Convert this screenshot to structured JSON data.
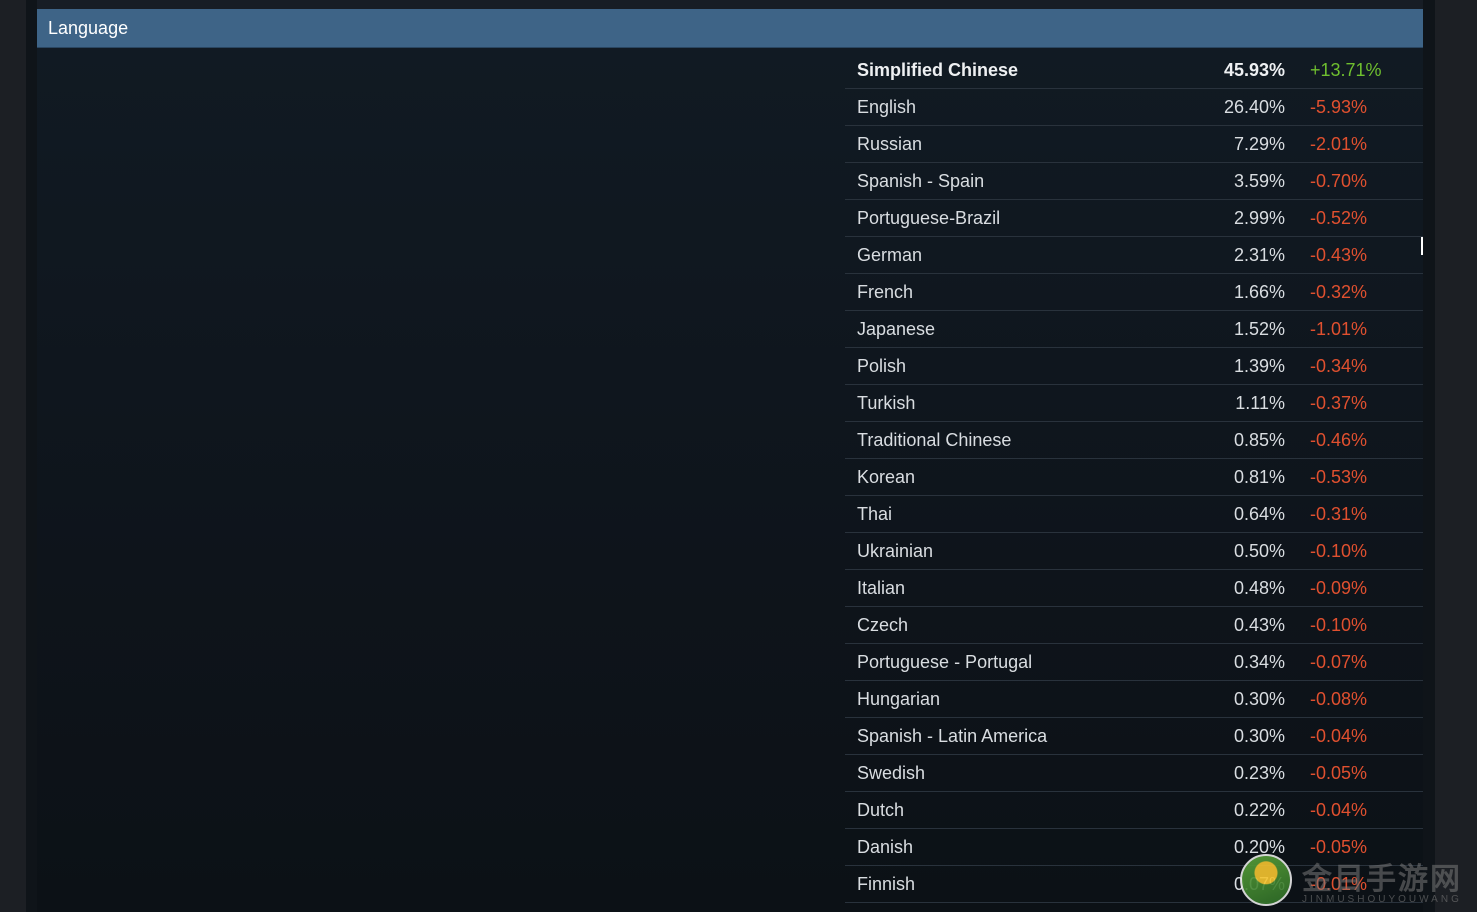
{
  "section": {
    "title": "Language"
  },
  "languages": [
    {
      "name": "Simplified Chinese",
      "share": "45.93%",
      "change": "+13.71%",
      "trend": "up"
    },
    {
      "name": "English",
      "share": "26.40%",
      "change": "-5.93%",
      "trend": "down"
    },
    {
      "name": "Russian",
      "share": "7.29%",
      "change": "-2.01%",
      "trend": "down"
    },
    {
      "name": "Spanish - Spain",
      "share": "3.59%",
      "change": "-0.70%",
      "trend": "down"
    },
    {
      "name": "Portuguese-Brazil",
      "share": "2.99%",
      "change": "-0.52%",
      "trend": "down"
    },
    {
      "name": "German",
      "share": "2.31%",
      "change": "-0.43%",
      "trend": "down"
    },
    {
      "name": "French",
      "share": "1.66%",
      "change": "-0.32%",
      "trend": "down"
    },
    {
      "name": "Japanese",
      "share": "1.52%",
      "change": "-1.01%",
      "trend": "down"
    },
    {
      "name": "Polish",
      "share": "1.39%",
      "change": "-0.34%",
      "trend": "down"
    },
    {
      "name": "Turkish",
      "share": "1.11%",
      "change": "-0.37%",
      "trend": "down"
    },
    {
      "name": "Traditional Chinese",
      "share": "0.85%",
      "change": "-0.46%",
      "trend": "down"
    },
    {
      "name": "Korean",
      "share": "0.81%",
      "change": "-0.53%",
      "trend": "down"
    },
    {
      "name": "Thai",
      "share": "0.64%",
      "change": "-0.31%",
      "trend": "down"
    },
    {
      "name": "Ukrainian",
      "share": "0.50%",
      "change": "-0.10%",
      "trend": "down"
    },
    {
      "name": "Italian",
      "share": "0.48%",
      "change": "-0.09%",
      "trend": "down"
    },
    {
      "name": "Czech",
      "share": "0.43%",
      "change": "-0.10%",
      "trend": "down"
    },
    {
      "name": "Portuguese - Portugal",
      "share": "0.34%",
      "change": "-0.07%",
      "trend": "down"
    },
    {
      "name": "Hungarian",
      "share": "0.30%",
      "change": "-0.08%",
      "trend": "down"
    },
    {
      "name": "Spanish - Latin America",
      "share": "0.30%",
      "change": "-0.04%",
      "trend": "down"
    },
    {
      "name": "Swedish",
      "share": "0.23%",
      "change": "-0.05%",
      "trend": "down"
    },
    {
      "name": "Dutch",
      "share": "0.22%",
      "change": "-0.04%",
      "trend": "down"
    },
    {
      "name": "Danish",
      "share": "0.20%",
      "change": "-0.05%",
      "trend": "down"
    },
    {
      "name": "Finnish",
      "share": "0.07%",
      "change": "-0.01%",
      "trend": "down"
    }
  ],
  "colors": {
    "header_bg": "#3e6487",
    "positive": "#6fbf2f",
    "negative": "#e0502f"
  },
  "watermark": {
    "text": "金目手游网",
    "subtext": "JINMUSHOUYOUWANG",
    "icon": "logo-icon"
  }
}
